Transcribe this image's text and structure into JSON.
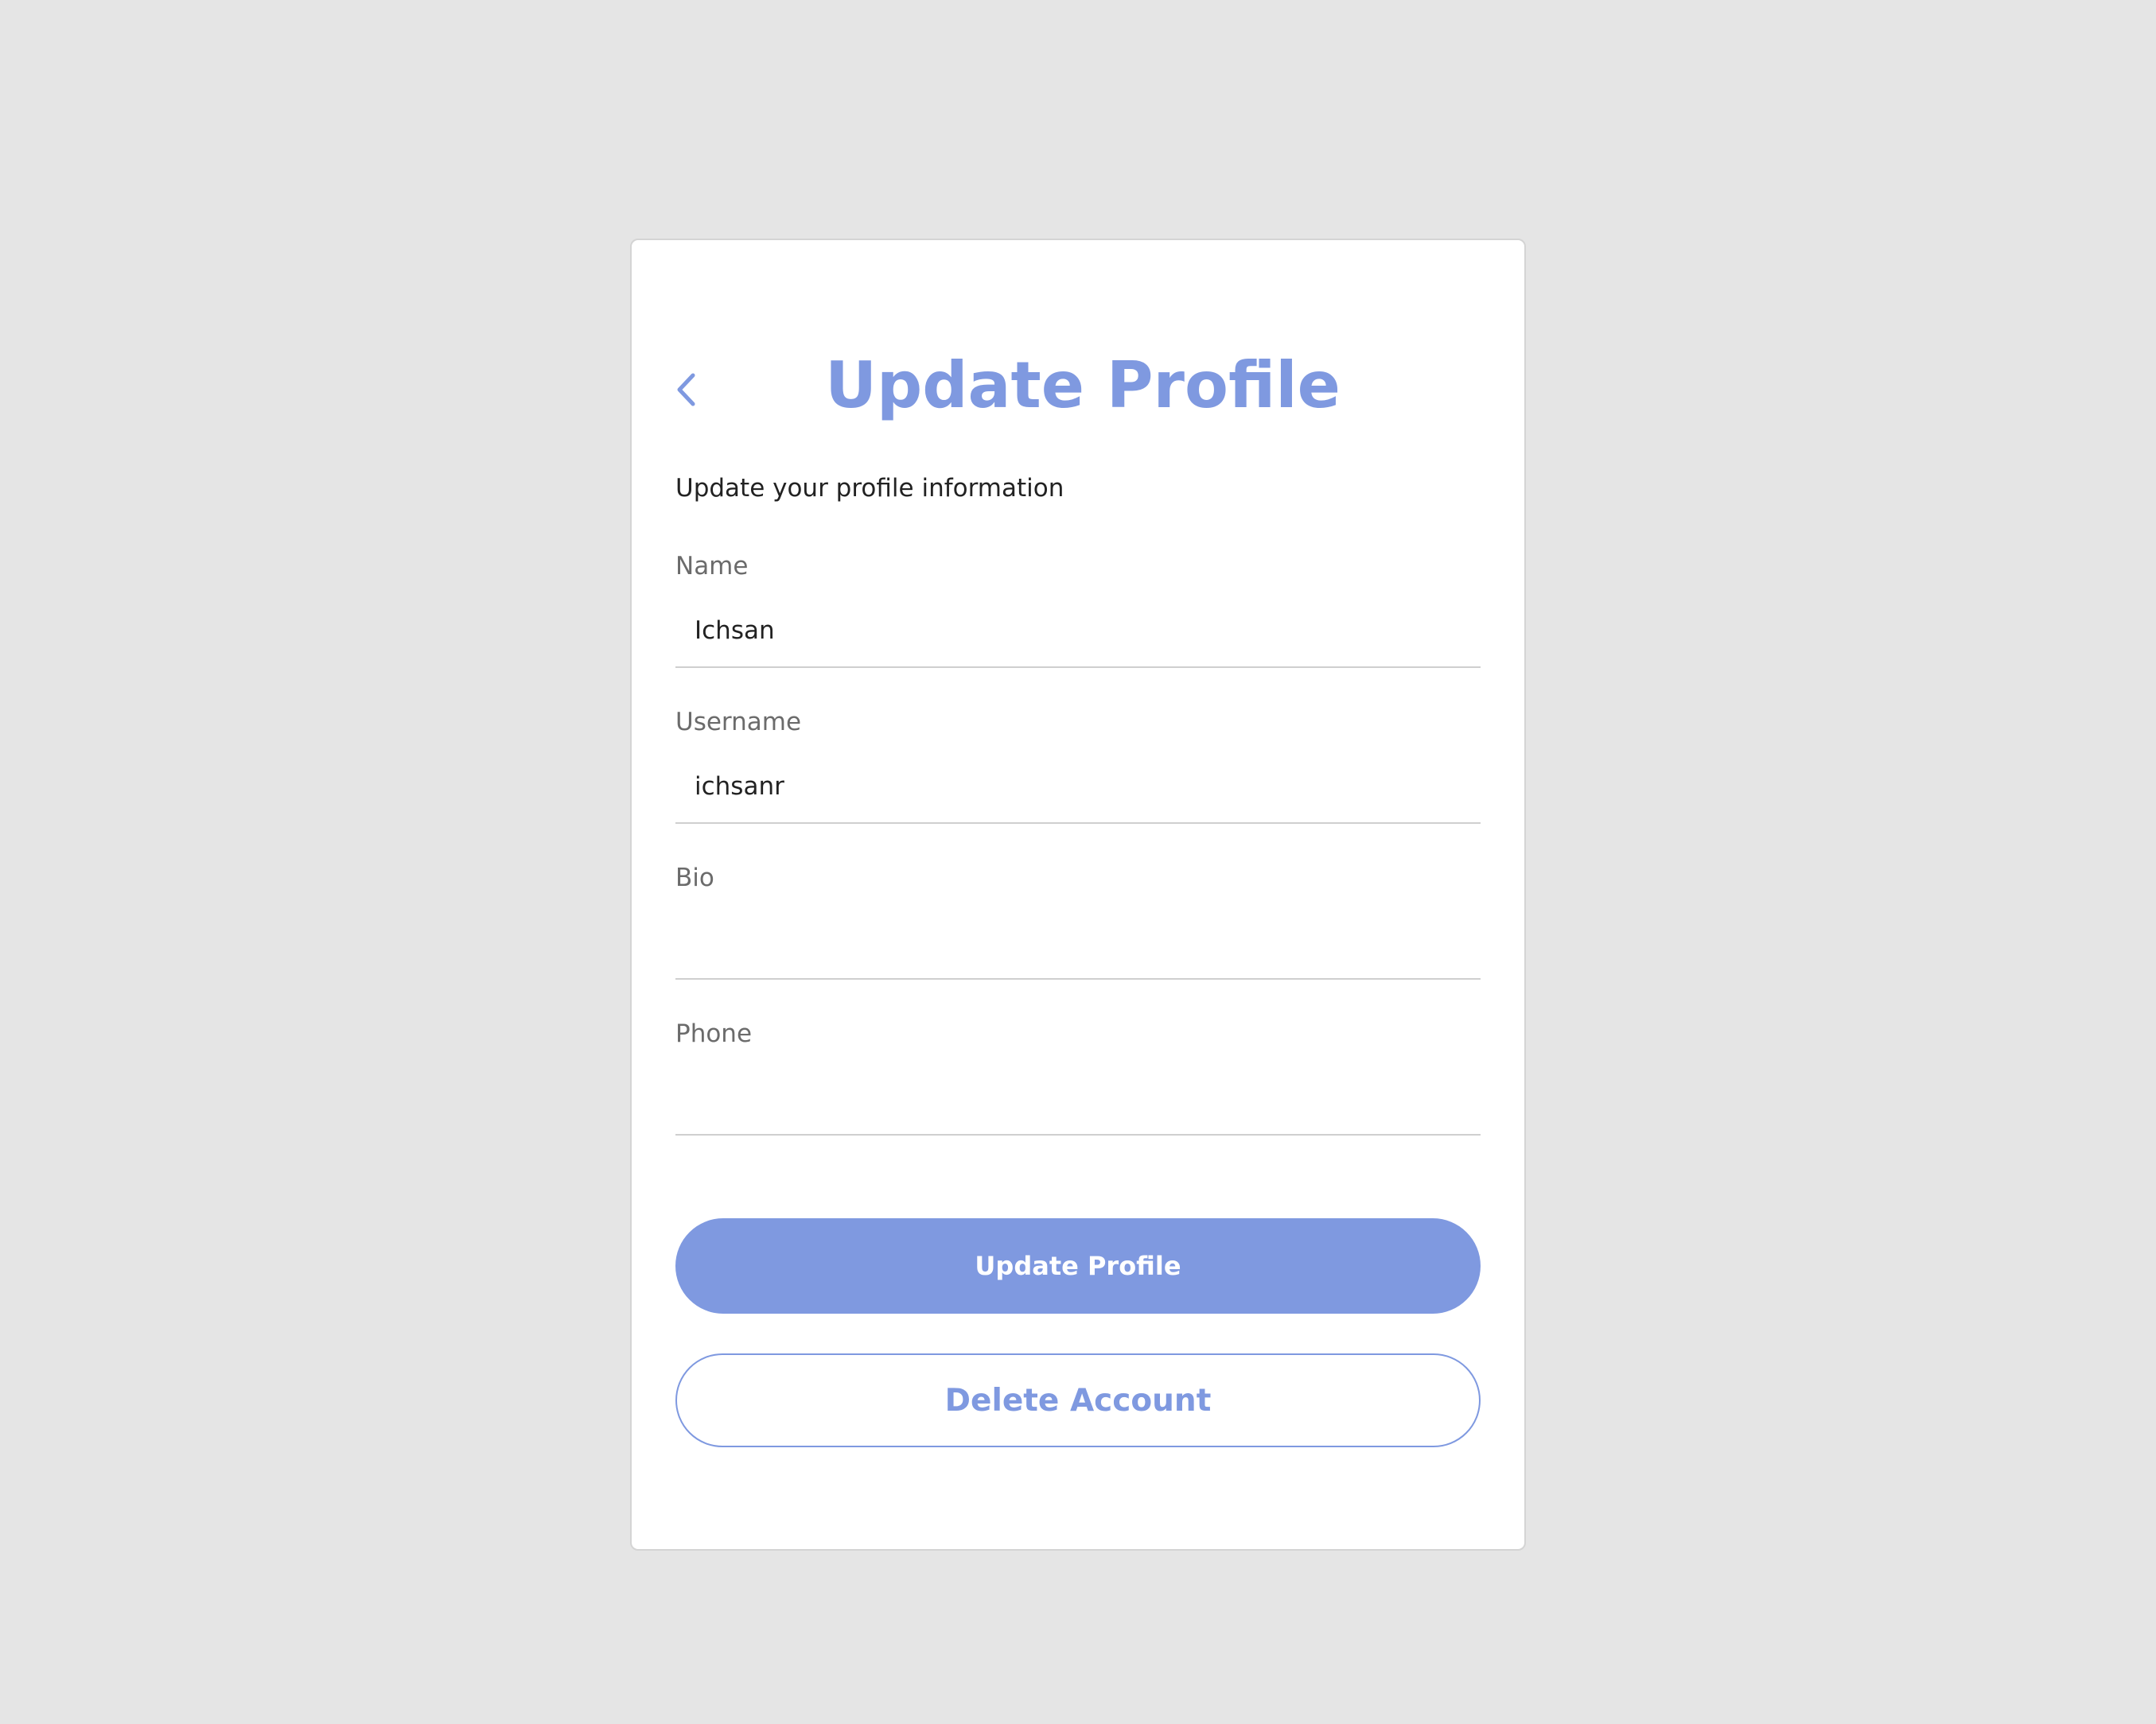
{
  "header": {
    "title": "Update Profile",
    "back_icon": "chevron-left-icon"
  },
  "form": {
    "subtitle": "Update your profile information",
    "fields": [
      {
        "label": "Name",
        "value": "Ichsan",
        "placeholder": ""
      },
      {
        "label": "Username",
        "value": "ichsanr",
        "placeholder": ""
      },
      {
        "label": "Bio",
        "value": "",
        "placeholder": ""
      },
      {
        "label": "Phone",
        "value": "",
        "placeholder": ""
      }
    ]
  },
  "actions": {
    "update_label": "Update Profile",
    "delete_label": "Delete Account"
  },
  "colors": {
    "accent": "#7f99e0",
    "background": "#e5e5e5",
    "card": "#ffffff"
  }
}
